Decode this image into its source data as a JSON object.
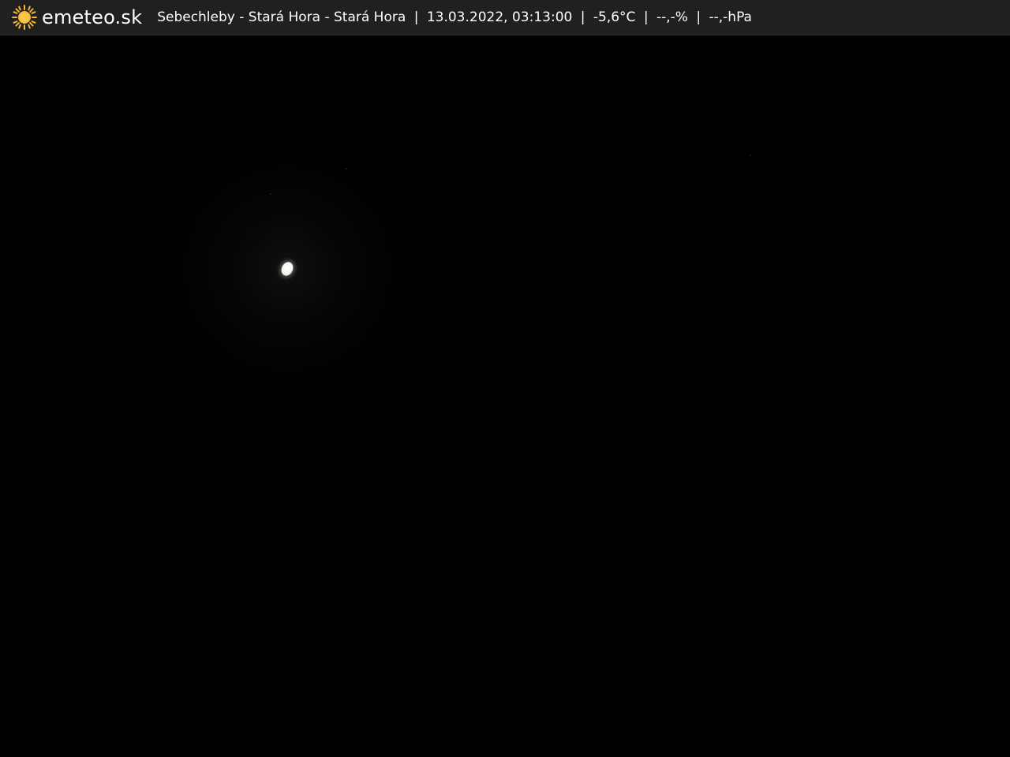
{
  "header": {
    "brand": "emeteo.sk",
    "location": "Sebechleby - Stará Hora - Stará Hora",
    "datetime": "13.03.2022, 03:13:00",
    "temperature": "-5,6°C",
    "humidity": "--,-%",
    "pressure": "--,-hPa",
    "separator": "|",
    "logo_icon": "sun-icon",
    "logo_color": "#f7b731"
  },
  "colors": {
    "bar_background": "#202020",
    "image_background": "#000000",
    "text": "#ffffff"
  }
}
